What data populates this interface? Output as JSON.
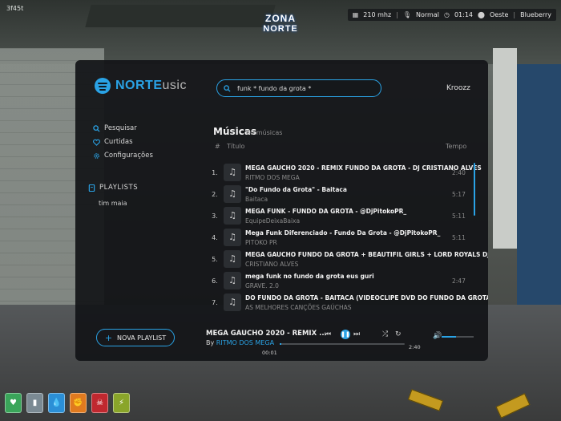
{
  "corner_tag": "3f45t",
  "brand_logo": {
    "line1": "ZONA",
    "line2": "NORTE"
  },
  "hud": {
    "fps": "210 mhz",
    "mic": "Normal",
    "time": "01:14",
    "location": "Oeste",
    "server": "Blueberry"
  },
  "app": {
    "title_strong": "NORTE",
    "title_light": "usic",
    "search": {
      "value": "funk * fundo da grota *",
      "placeholder": ""
    },
    "user": "Kroozz",
    "nav": [
      {
        "label": "Pesquisar",
        "icon": "search-icon"
      },
      {
        "label": "Curtidas",
        "icon": "heart-icon"
      },
      {
        "label": "Configurações",
        "icon": "gear-icon"
      }
    ],
    "playlists_heading": "PLAYLISTS",
    "playlists": [
      "tim maia"
    ],
    "new_playlist_label": "NOVA PLAYLIST",
    "section_title": "Músicas",
    "section_count": "80 músicas",
    "columns": {
      "num": "#",
      "title": "Título",
      "time": "Tempo"
    },
    "tracks": [
      {
        "num": "1.",
        "title": "MEGA GAUCHO 2020 - REMIX FUNDO DA GROTA - DJ CRISTIANO ALVES",
        "artist": "RITMO DOS MEGA",
        "duration": "2:40"
      },
      {
        "num": "2.",
        "title": "\"Do Fundo da Grota\" - Baitaca",
        "artist": "Baitaca",
        "duration": "5:17"
      },
      {
        "num": "3.",
        "title": "MEGA FUNK - FUNDO DA GROTA - @DjPitokoPR_",
        "artist": "EquipeDeixaBaixa",
        "duration": "5:11"
      },
      {
        "num": "4.",
        "title": "Mega Funk Diferenciado - Fundo Da Grota - @DjPitokoPR_",
        "artist": "PITOKO PR",
        "duration": "5:11"
      },
      {
        "num": "5.",
        "title": "MEGA GAUCHO FUNDO DA GROTA + BEAUTIFIL GIRLS + LORD ROYALS   DJ CRISTIANO ALVES",
        "artist": "CRISTIANO ALVES",
        "duration": ""
      },
      {
        "num": "6.",
        "title": "mega funk no fundo da grota eus guri",
        "artist": "GRAVE. 2.0",
        "duration": "2:47"
      },
      {
        "num": "7.",
        "title": "DO FUNDO DA GROTA - BAITACA (VIDEOCLIPE DVD DO FUNDO DA GROTA)",
        "artist": "AS MELHORES CANÇÕES GAÚCHAS",
        "duration": ""
      }
    ],
    "now_playing": {
      "title": "MEGA GAUCHO 2020 - REMIX ...",
      "by_label": "By",
      "artist": "RITMO DOS MEGA",
      "current_time": "00:01",
      "total_time": "2:40",
      "progress": 0.01,
      "volume": 0.45
    }
  },
  "status_icons": [
    "heart-icon",
    "bottle-icon",
    "drop-icon",
    "fist-icon",
    "skull-icon",
    "bolt-icon"
  ],
  "status_colors": [
    "#3aa55a",
    "#7b8a93",
    "#2b8fd6",
    "#e07a1f",
    "#c0282f",
    "#8aa52a"
  ],
  "accent": "#2aa3e6"
}
